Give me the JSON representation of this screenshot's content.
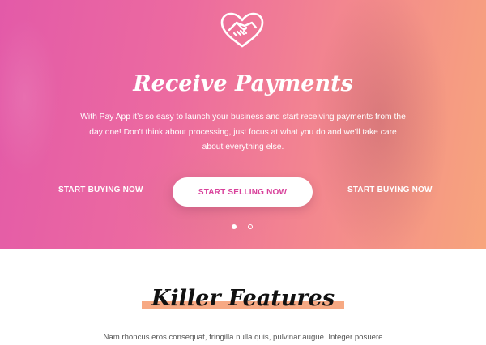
{
  "hero": {
    "logo_icon": "handshake-heart-icon",
    "title": "Receive Payments",
    "description": "With Pay App it’s so easy to launch your business and start receiving payments from the day one! Don’t think about processing, just focus at what you do and we’ll take care about everything else.",
    "cta_left": "START BUYING NOW",
    "cta_main": "START SELLING NOW",
    "cta_right": "START BUYING NOW",
    "slides": {
      "active": 1,
      "count": 2
    },
    "colors": {
      "gradient_start": "#e35aa8",
      "gradient_end": "#f7a57c",
      "accent_text": "#d8409a"
    }
  },
  "features": {
    "title": "Killer Features",
    "description": "Nam rhoncus eros consequat, fringilla nulla quis, pulvinar augue. Integer posuere",
    "highlight_color": "#f7a983"
  }
}
